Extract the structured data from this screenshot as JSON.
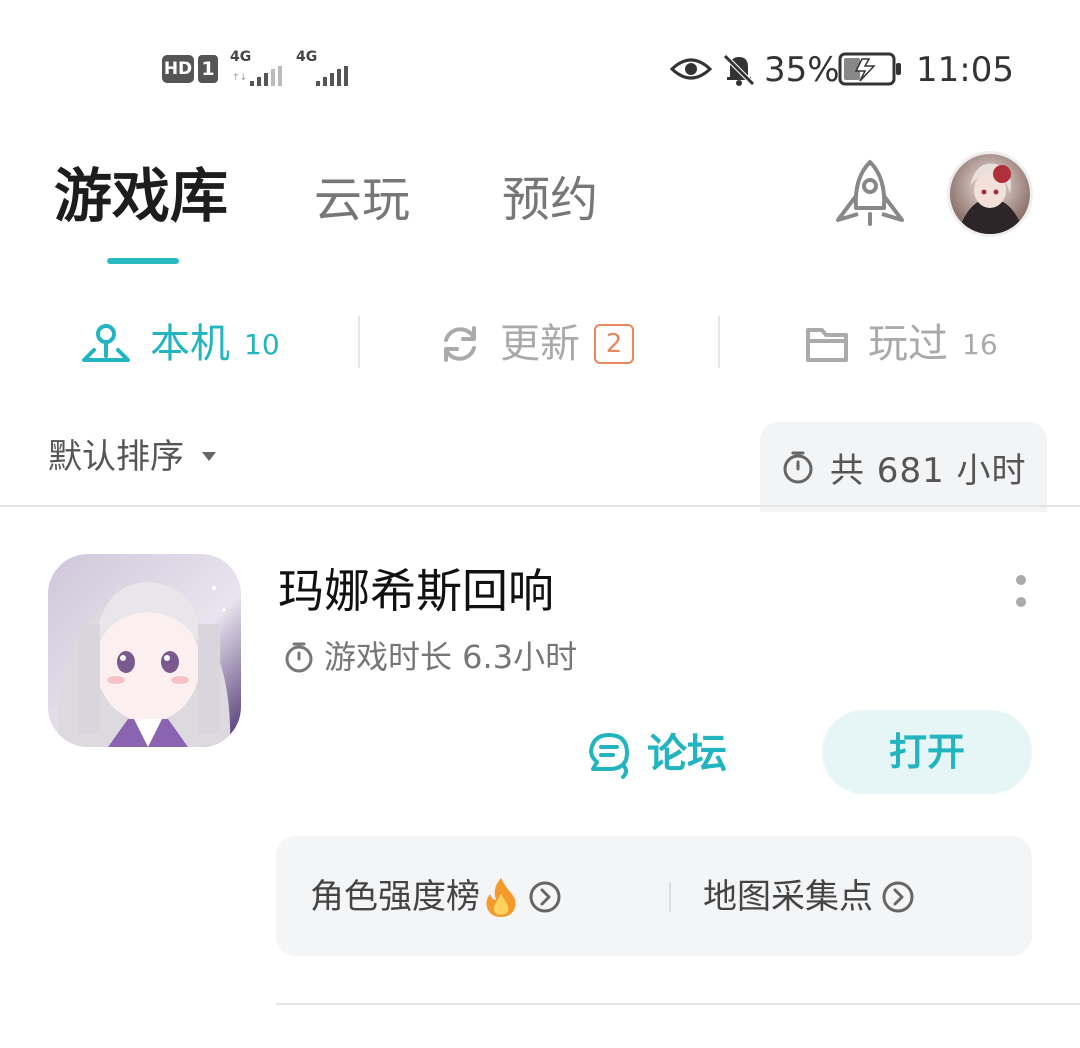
{
  "status_bar": {
    "hd_label": "HD",
    "sim_label": "1",
    "net1_label": "4G",
    "net2_label": "4G",
    "battery_percent": "35%",
    "battery_level": 0.35,
    "time": "11:05"
  },
  "top_tabs": [
    {
      "label": "游戏库",
      "active": true
    },
    {
      "label": "云玩",
      "active": false
    },
    {
      "label": "预约",
      "active": false
    }
  ],
  "sub_tabs": {
    "local": {
      "label": "本机",
      "count": "10"
    },
    "update": {
      "label": "更新",
      "badge": "2"
    },
    "played": {
      "label": "玩过",
      "count": "16"
    }
  },
  "sort": {
    "label": "默认排序",
    "total_label": "共 681 小时"
  },
  "game": {
    "title": "玛娜希斯回响",
    "play_time": "游戏时长 6.3小时",
    "forum_label": "论坛",
    "open_label": "打开",
    "quick_links": [
      {
        "label": "角色强度榜",
        "hot": true
      },
      {
        "label": "地图采集点",
        "hot": false
      }
    ]
  },
  "colors": {
    "accent": "#22b5bf",
    "badge_orange": "#e7875d",
    "muted": "#aaaaaa"
  }
}
